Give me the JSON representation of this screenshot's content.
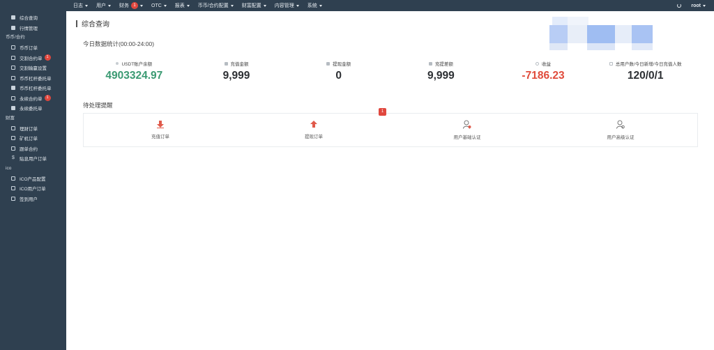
{
  "topnav": {
    "items": [
      {
        "label": "日志",
        "badge": ""
      },
      {
        "label": "用户",
        "badge": ""
      },
      {
        "label": "财务",
        "badge": "1"
      },
      {
        "label": "OTC",
        "badge": ""
      },
      {
        "label": "报表",
        "badge": ""
      },
      {
        "label": "币币/合约配置",
        "badge": ""
      },
      {
        "label": "财富配置",
        "badge": ""
      },
      {
        "label": "内容管理",
        "badge": ""
      },
      {
        "label": "系统",
        "badge": ""
      }
    ],
    "username": "root"
  },
  "sidebar": {
    "top_items": [
      {
        "label": "综合查询"
      },
      {
        "label": "行情管理"
      }
    ],
    "groups": [
      {
        "title": "币币/合约",
        "items": [
          {
            "label": "币币订单",
            "badge": ""
          },
          {
            "label": "交割合约单",
            "badge": "1"
          },
          {
            "label": "交割输赢设置",
            "badge": ""
          },
          {
            "label": "币币杠杆委托单",
            "badge": ""
          },
          {
            "label": "币币杠杆委托单",
            "badge": ""
          },
          {
            "label": "永续合约单",
            "badge": "1"
          },
          {
            "label": "永续委托单",
            "badge": ""
          }
        ]
      },
      {
        "title": "财富",
        "items": [
          {
            "label": "理财订单",
            "badge": ""
          },
          {
            "label": "矿机订单",
            "badge": ""
          },
          {
            "label": "跟单合约",
            "badge": ""
          },
          {
            "label": "贴息用户订单",
            "badge": ""
          }
        ]
      },
      {
        "title": "ico",
        "items": [
          {
            "label": "ICO产品配置",
            "badge": ""
          },
          {
            "label": "ICO用户订单",
            "badge": ""
          },
          {
            "label": "签到用户",
            "badge": ""
          }
        ]
      }
    ]
  },
  "main": {
    "title": "综合查询",
    "stats_title": "今日数据统计(00:00-24:00)",
    "stats": [
      {
        "label": "USDT账户余额",
        "value": "4903324.97"
      },
      {
        "label": "充值金额",
        "value": "9,999"
      },
      {
        "label": "提现金额",
        "value": "0"
      },
      {
        "label": "充提差额",
        "value": "9,999"
      },
      {
        "label": "收益",
        "value": "-7186.23"
      },
      {
        "label": "总用户数/今日新增/今日充值人数",
        "value": "120/0/1"
      }
    ],
    "tasks_title": "待处理提醒",
    "tasks_badge": "1",
    "tasks": [
      {
        "label": "充值订单"
      },
      {
        "label": "提现订单"
      },
      {
        "label": "用户基础认证"
      },
      {
        "label": "用户高级认证"
      }
    ]
  },
  "colors": {
    "sidebar_bg": "#2f4050",
    "badge": "#e0473e",
    "positive": "#3a9a72",
    "negative": "#e04b3b",
    "arrow_down": "#e05a4b",
    "arrow_up": "#e05a4b"
  },
  "icons": {
    "task_icons": [
      "arrow-down-icon",
      "arrow-up-icon",
      "user-check-icon",
      "user-settings-icon"
    ]
  }
}
